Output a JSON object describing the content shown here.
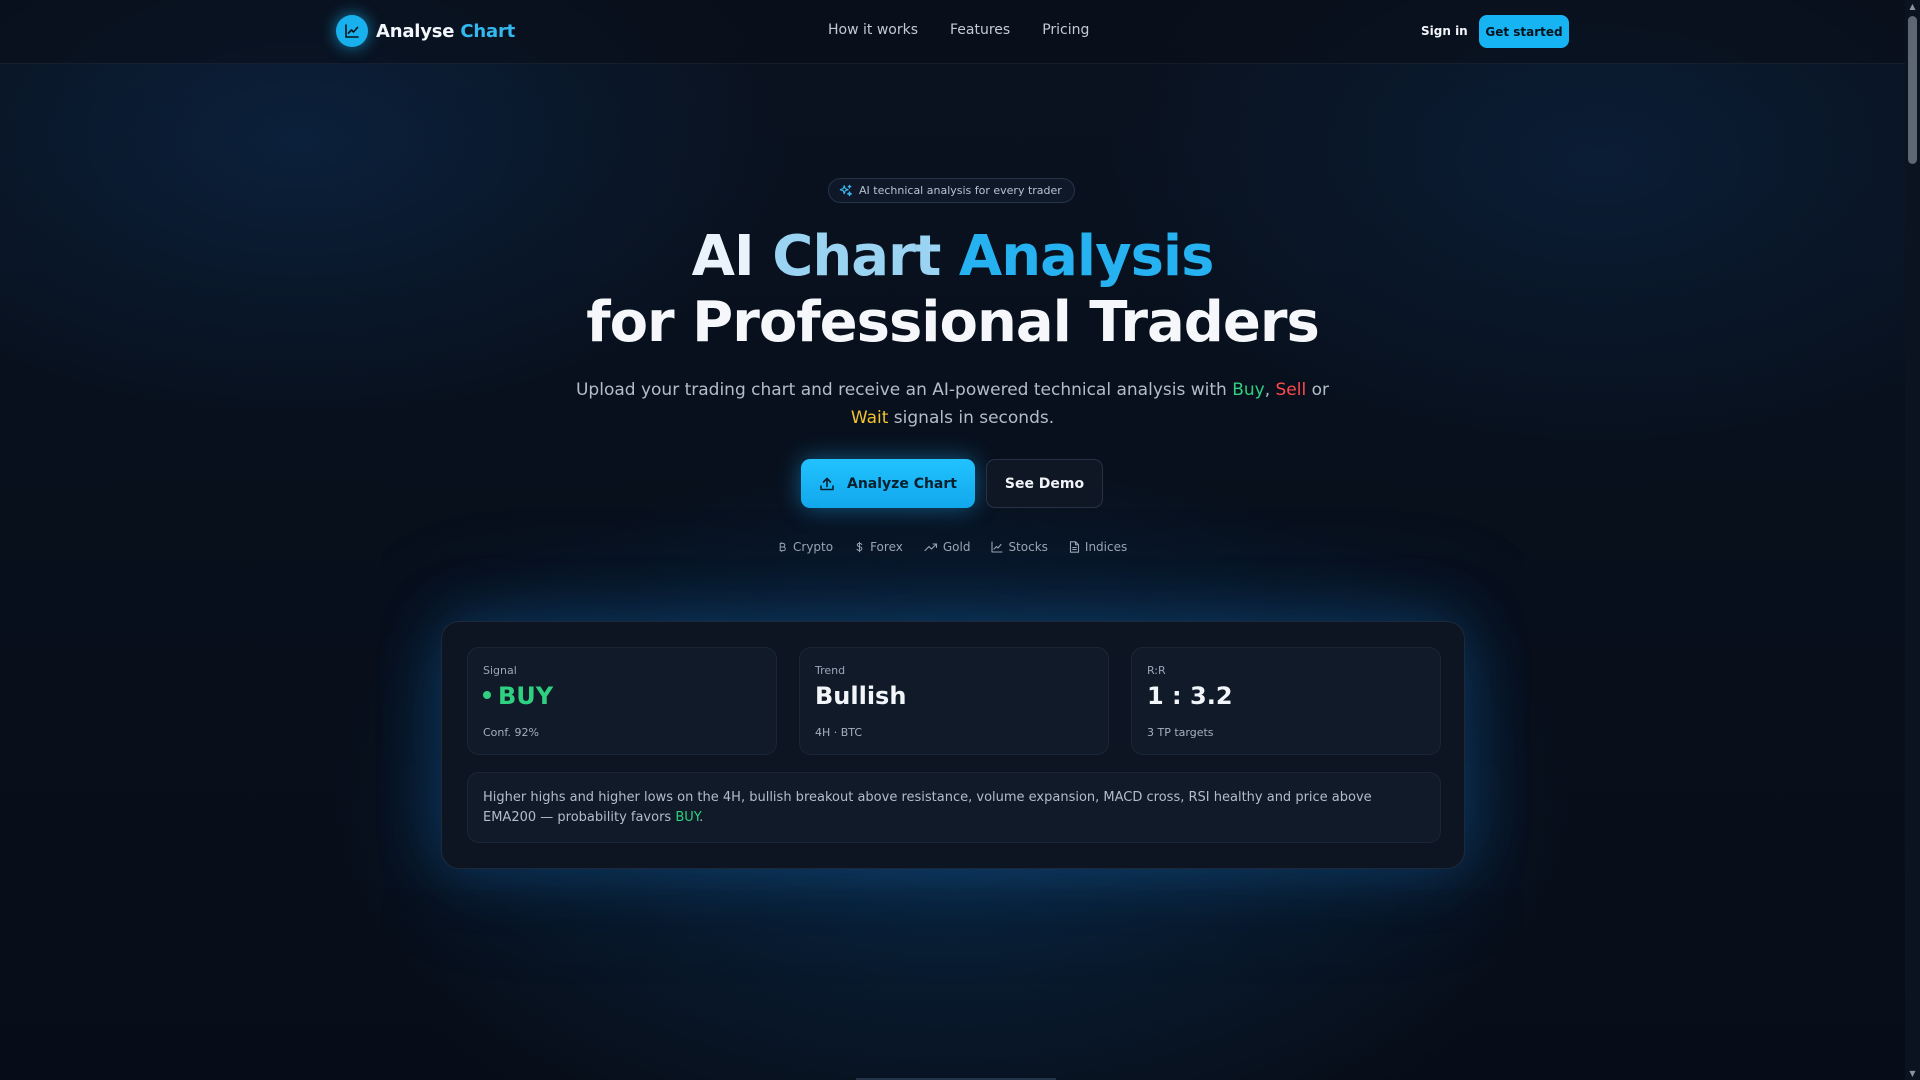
{
  "brand": {
    "name_part1": "Analyse",
    "name_part2": " Chart"
  },
  "nav": {
    "links": [
      "How it works",
      "Features",
      "Pricing"
    ],
    "sign_in": "Sign in",
    "get_started": "Get started"
  },
  "hero": {
    "badge": "AI technical analysis for every trader",
    "title_line1_word1": "AI ",
    "title_line1_word2": "Chart ",
    "title_line1_word3": "Analysis",
    "title_line2": "for Professional Traders",
    "subtitle_pre": "Upload your trading chart and receive an AI-powered technical analysis with ",
    "subtitle_buy": "Buy",
    "subtitle_comma": ", ",
    "subtitle_sell": "Sell",
    "subtitle_or": " or",
    "subtitle_wait": "Wait",
    "subtitle_post": " signals in seconds.",
    "primary_button": "Analyze Chart",
    "secondary_button": "See Demo",
    "markets": [
      "Crypto",
      "Forex",
      "Gold",
      "Stocks",
      "Indices"
    ]
  },
  "preview": {
    "signal": {
      "label": "Signal",
      "value": "BUY",
      "meta": "Conf. 92%"
    },
    "trend": {
      "label": "Trend",
      "value": "Bullish",
      "meta": "4H · BTC"
    },
    "rr": {
      "label": "R:R",
      "value": "1 : 3.2",
      "meta": "3 TP targets"
    },
    "summary_text": "Higher highs and higher lows on the 4H, bullish breakout above resistance, volume expansion, MACD cross, RSI healthy and price above EMA200 — probability favors ",
    "summary_signal": "BUY",
    "summary_end": "."
  },
  "colors": {
    "accent": "#17b4f3",
    "buy": "#2fd07f",
    "sell": "#ff4b4b",
    "wait": "#f2c230",
    "background": "#070d18"
  }
}
